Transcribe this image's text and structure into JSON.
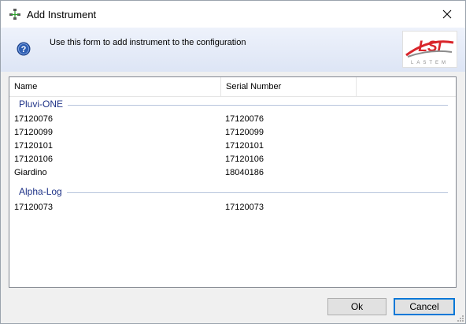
{
  "window": {
    "title": "Add Instrument",
    "icon": "instrument-network-icon",
    "close_icon": "close-icon"
  },
  "header": {
    "text": "Use this form to add instrument to the configuration",
    "help_icon": "help-icon",
    "logo": {
      "text": "LSI",
      "subtext": "LASTEM",
      "color": "#d9252b"
    }
  },
  "list": {
    "columns": [
      "Name",
      "Serial Number"
    ],
    "groups": [
      {
        "label": "Pluvi-ONE",
        "items": [
          {
            "name": "17120076",
            "serial": "17120076"
          },
          {
            "name": "17120099",
            "serial": "17120099"
          },
          {
            "name": "17120101",
            "serial": "17120101"
          },
          {
            "name": "17120106",
            "serial": "17120106"
          },
          {
            "name": "Giardino",
            "serial": "18040186"
          }
        ]
      },
      {
        "label": "Alpha-Log",
        "items": [
          {
            "name": "17120073",
            "serial": "17120073"
          }
        ]
      }
    ]
  },
  "buttons": {
    "ok": "Ok",
    "cancel": "Cancel"
  },
  "colors": {
    "group_label": "#1e3287",
    "accent": "#0078d7"
  }
}
